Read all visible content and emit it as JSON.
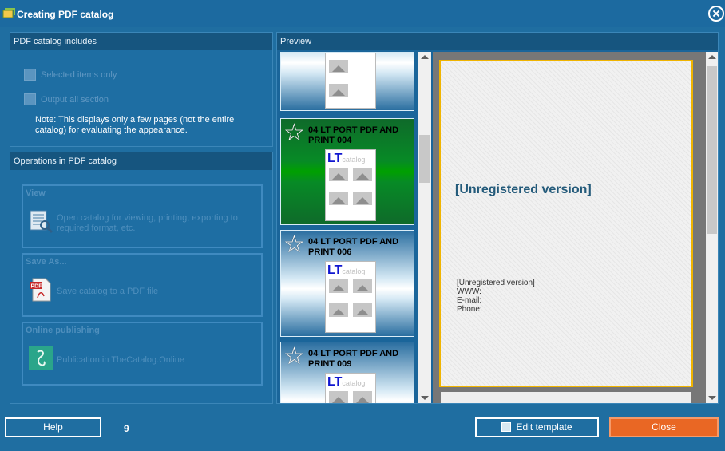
{
  "window": {
    "title": "Creating PDF catalog"
  },
  "includes": {
    "header": "PDF catalog includes",
    "selected_only": "Selected items only",
    "output_all": "Output all section",
    "note": "Note: This displays only a few pages (not the entire catalog) for evaluating the appearance."
  },
  "operations": {
    "header": "Operations in PDF catalog",
    "view": {
      "title": "View",
      "desc": "Open catalog for viewing, printing, exporting to required format, etc.",
      "icon": "catalog-search-icon"
    },
    "save": {
      "title": "Save As...",
      "desc": "Save catalog to a PDF file",
      "icon": "pdf-file-icon"
    },
    "online": {
      "title": "Online publishing",
      "desc": "Publication in TheCatalog.Online",
      "icon": "thecatalog-online-icon"
    }
  },
  "preview": {
    "header": "Preview",
    "thumbnails": [
      {
        "title": "",
        "selected": false
      },
      {
        "title": "04 LT PORT PDF AND PRINT 004",
        "selected": true
      },
      {
        "title": "04 LT PORT PDF AND PRINT 006",
        "selected": false
      },
      {
        "title": "04 LT PORT PDF AND PRINT 009",
        "selected": false
      }
    ],
    "mini_logo": "LT",
    "mini_logo_sub": "catalog",
    "page": {
      "unregistered_big": "[Unregistered version]",
      "info_lines": [
        "[Unregistered version]",
        "WWW:",
        "E-mail:",
        "Phone:"
      ]
    }
  },
  "footer": {
    "help_label": "Help",
    "page_count": "9",
    "edit_label": "Edit template",
    "close_label": "Close"
  },
  "colors": {
    "accent": "#1f6ea1",
    "close_button": "#e96724",
    "selected_thumb": "#078a26",
    "page_border": "#f0b400"
  }
}
